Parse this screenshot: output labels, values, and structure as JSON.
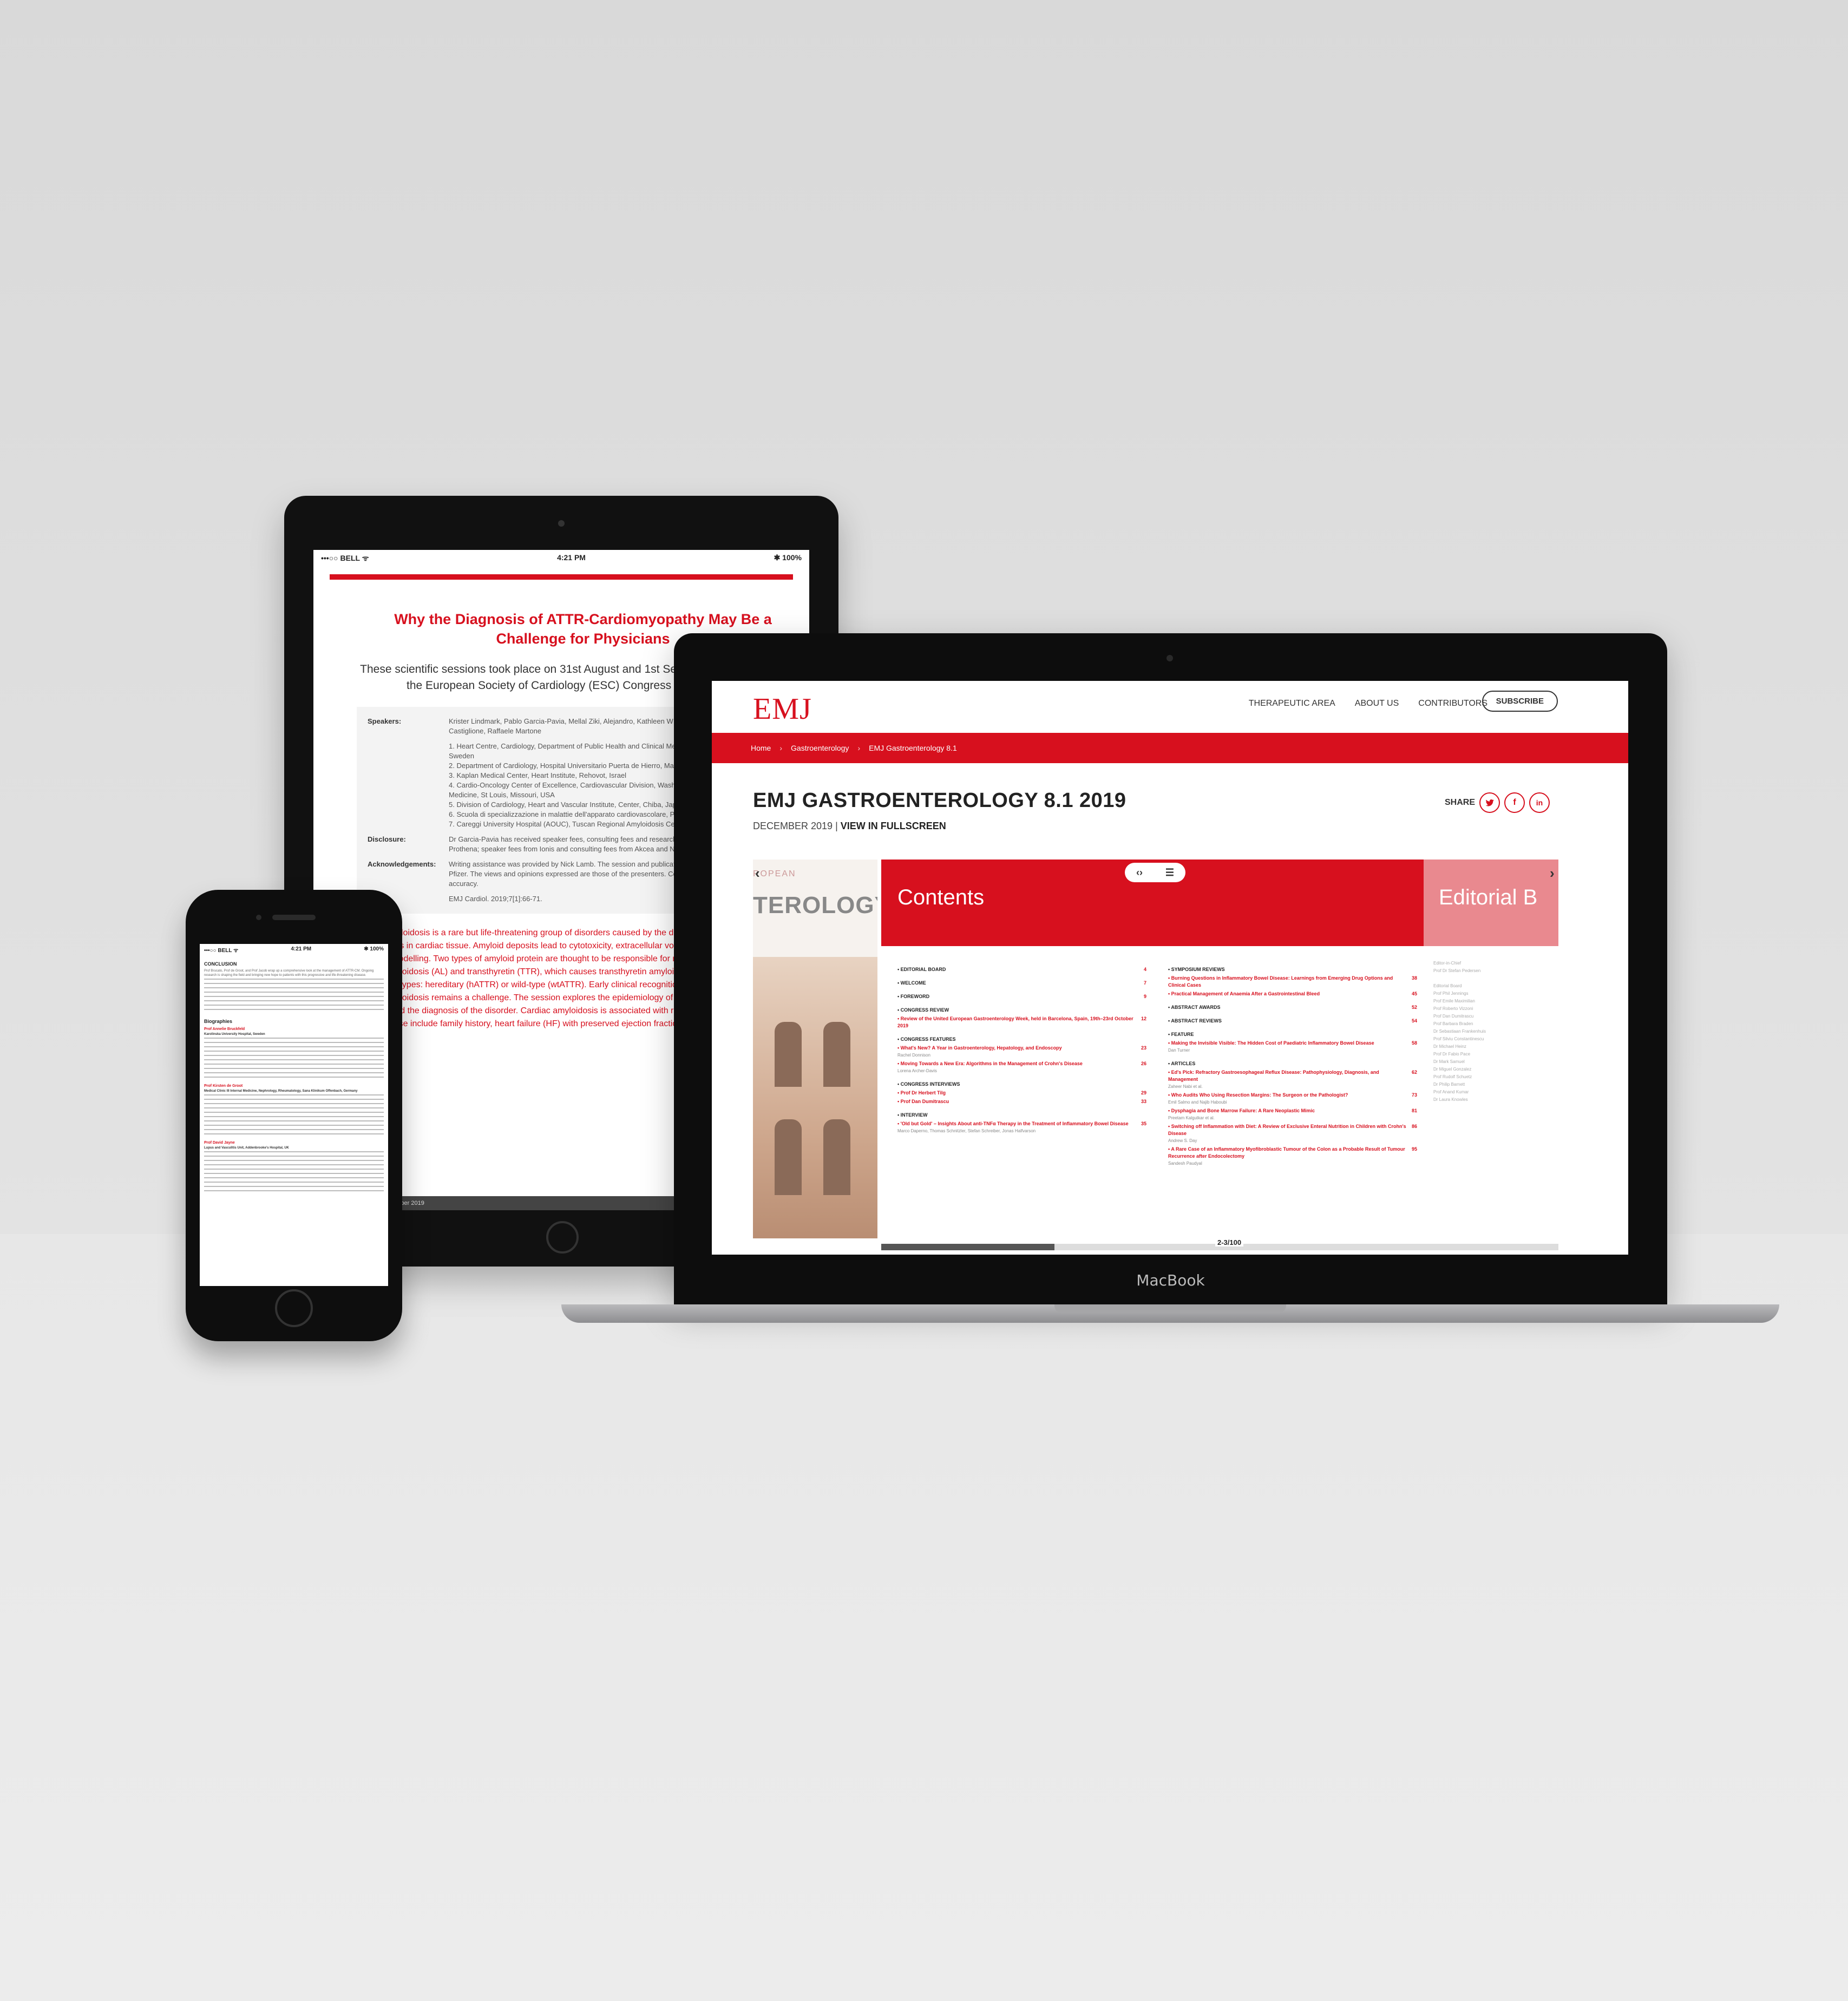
{
  "tablet": {
    "status_left": "•••○○ BELL ᯤ",
    "status_time": "4:21 PM",
    "status_right": "✱ 100%",
    "title": "Why the Diagnosis of ATTR-Cardiomyopathy May Be a Challenge for Physicians",
    "intro": "These scientific sessions took place on 31st August and 1st September 2019, as part of the European Society of Cardiology (ESC) Congress in Paris, France",
    "speakers_label": "Speakers:",
    "speakers": "Krister Lindmark, Pablo Garcia-Pavia, Mellal Ziki, Alejandro, Kathleen W Zhang, Shigeru Fukushima, Castiglione, Raffaele Martone",
    "affiliations": "1. Heart Centre, Cardiology, Department of Public Health and Clinical Medicine, Umeå University, Umeå, Sweden\n2. Department of Cardiology, Hospital Universitario Puerta de Hierro, Madrid, Spain\n3. Kaplan Medical Center, Heart Institute, Rehovot, Israel\n4. Cardio-Oncology Center of Excellence, Cardiovascular Division, Washington University School of Medicine, St Louis, Missouri, USA\n5. Division of Cardiology, Heart and Vascular Institute, Center, Chiba, Japan\n6. Scuola di specializzazione in malattie dell'apparato cardiovascolare, Pisa, Pisa, Italy\n7. Careggi University Hospital (AOUC), Tuscan Regional Amyloidosis Centre, Florence, Italy",
    "disclosure_label": "Disclosure:",
    "disclosure": "Dr Garcia-Pavia has received speaker fees, consulting fees and research support from Alnylam, Pfizer and Prothena; speaker fees from Ionis and consulting fees from Akcea and Neurimmune.",
    "ack_label": "Acknowledgements:",
    "ack": "Writing assistance was provided by Nick Lamb. The session and publication of this article were funded by Pfizer. The views and opinions expressed are those of the presenters. Content was reviewed for medical accuracy.",
    "citation": "EMJ Cardiol. 2019;7[1]:66-71.",
    "body": "Amyloidosis is a rare but life-threatening group of disorders caused by the deposition of misfolded amyloid fibrils in cardiac tissue. Amyloid deposits lead to cytotoxicity, extracellular volume expansion, and ventricular remodelling. Two types of amyloid protein are thought to be responsible for most disorders: light chain amyloidosis (AL) and transthyretin (TTR), which causes transthyretin amyloidosis (ATTR), of which there are two types: hereditary (hATTR) or wild-type (wtATTR). Early clinical recognition of the disease, cardiac amyloidosis remains a challenge. The session explores the epidemiology of AL and ATTR and the biomarkers to aid the diagnosis of the disorder. Cardiac amyloidosis is associated with rising red flag symptom clusters. These include family history, heart failure (HF) with preserved ejection fraction (HFpEF) without...",
    "footer": "EMJ CARDIOLOGY • October 2019"
  },
  "phone": {
    "status_left": "•••○○ BELL ᯤ",
    "status_time": "4:21 PM",
    "status_right": "✱ 100%",
    "heading": "CONCLUSION",
    "conclusion": "Prof Brucato, Prof de Groot, and Prof Jacob wrap up a comprehensive look at the management of ATTR-CM. Ongoing research is shaping the field and bringing new hope to patients with this progressive and life-threatening disease.",
    "bios_heading": "Biographies",
    "bio1_name": "Prof Annelie Bruckfeld",
    "bio1_aff": "Karolinska University Hospital, Sweden",
    "bio2_name": "Prof Kirsten de Groot",
    "bio2_aff": "Medical Clinic III Internal Medicine, Nephrology, Rheumatology, Sana Klinikum Offenbach, Germany",
    "bio3_name": "Prof David Jayne",
    "bio3_aff": "Lupus and Vasculitis Unit, Addenbrooke's Hospital, UK"
  },
  "laptop": {
    "brand": "MacBook",
    "logo": "EMJ",
    "nav": {
      "therapeutic_area": "THERAPEUTIC AREA",
      "about": "ABOUT US",
      "contributors": "CONTRIBUTORS",
      "subscribe": "SUBSCRIBE"
    },
    "breadcrumbs": {
      "home": "Home",
      "sep": "›",
      "section": "Gastroenterology",
      "current": "EMJ Gastroenterology 8.1"
    },
    "title": "EMJ GASTROENTEROLOGY 8.1 2019",
    "date": "DECEMBER 2019",
    "divider": "|",
    "fullscreen": "VIEW IN FULLSCREEN",
    "share_label": "SHARE",
    "share_icons": [
      "twitter-icon",
      "facebook-icon",
      "linkedin-icon"
    ],
    "viewer": {
      "cover_top": "ROPEAN",
      "cover_big": "TEROLOGY",
      "contents_title": "Contents",
      "next_title": "Editorial B",
      "page_counter": "2-3/100",
      "left_col": [
        {
          "type": "sec",
          "label": "EDITORIAL BOARD",
          "page": "4"
        },
        {
          "type": "sec",
          "label": "WELCOME",
          "page": "7"
        },
        {
          "type": "sec",
          "label": "FOREWORD",
          "page": "9"
        },
        {
          "type": "sec",
          "label": "CONGRESS REVIEW",
          "page": ""
        },
        {
          "type": "item",
          "label": "Review of the United European Gastroenterology Week, held in Barcelona, Spain, 19th–23rd October 2019",
          "page": "12"
        },
        {
          "type": "sec",
          "label": "CONGRESS FEATURES",
          "page": ""
        },
        {
          "type": "item",
          "label": "What's New? A Year in Gastroenterology, Hepatology, and Endoscopy",
          "page": "23"
        },
        {
          "type": "auth",
          "label": "Rachel Donnison"
        },
        {
          "type": "item",
          "label": "Moving Towards a New Era: Algorithms in the Management of Crohn's Disease",
          "page": "26"
        },
        {
          "type": "auth",
          "label": "Lorena Archer-Davis"
        },
        {
          "type": "sec",
          "label": "CONGRESS INTERVIEWS",
          "page": ""
        },
        {
          "type": "item",
          "label": "Prof Dr Herbert Tilg",
          "page": "29"
        },
        {
          "type": "item",
          "label": "Prof Dan Dumitrascu",
          "page": "33"
        },
        {
          "type": "sec",
          "label": "INTERVIEW",
          "page": ""
        },
        {
          "type": "item",
          "label": "'Old but Gold' – Insights About anti-TNFα Therapy in the Treatment of Inflammatory Bowel Disease",
          "page": "35"
        },
        {
          "type": "auth",
          "label": "Marco Daperno, Thomas Schnitzler, Stefan Schreiber, Jonas Halfvarson"
        }
      ],
      "right_col": [
        {
          "type": "sec",
          "label": "SYMPOSIUM REVIEWS",
          "page": ""
        },
        {
          "type": "item",
          "label": "Burning Questions in Inflammatory Bowel Disease: Learnings from Emerging Drug Options and Clinical Cases",
          "page": "38"
        },
        {
          "type": "item",
          "label": "Practical Management of Anaemia After a Gastrointestinal Bleed",
          "page": "45"
        },
        {
          "type": "sec",
          "label": "ABSTRACT AWARDS",
          "page": "52"
        },
        {
          "type": "sec",
          "label": "ABSTRACT REVIEWS",
          "page": "54"
        },
        {
          "type": "sec",
          "label": "FEATURE",
          "page": ""
        },
        {
          "type": "item",
          "label": "Making the Invisible Visible: The Hidden Cost of Paediatric Inflammatory Bowel Disease",
          "page": "58"
        },
        {
          "type": "auth",
          "label": "Dan Turner"
        },
        {
          "type": "sec",
          "label": "ARTICLES",
          "page": ""
        },
        {
          "type": "item",
          "label": "Ed's Pick: Refractory Gastroesophageal Reflux Disease: Pathophysiology, Diagnosis, and Management",
          "page": "62"
        },
        {
          "type": "auth",
          "label": "Zaheer Nabi et al."
        },
        {
          "type": "item",
          "label": "Who Audits Who Using Resection Margins: The Surgeon or the Pathologist?",
          "page": "73"
        },
        {
          "type": "auth",
          "label": "Emil Salmo and Najib Haboubi"
        },
        {
          "type": "item",
          "label": "Dysphagia and Bone Marrow Failure: A Rare Neoplastic Mimic",
          "page": "81"
        },
        {
          "type": "auth",
          "label": "Preetam Kalgutkar et al."
        },
        {
          "type": "item",
          "label": "Switching off Inflammation with Diet: A Review of Exclusive Enteral Nutrition in Children with Crohn's Disease",
          "page": "86"
        },
        {
          "type": "auth",
          "label": "Andrew S. Day"
        },
        {
          "type": "item",
          "label": "A Rare Case of an Inflammatory Myofibroblastic Tumour of the Colon as a Probable Result of Tumour Recurrence after Endocolectomy",
          "page": "95"
        },
        {
          "type": "auth",
          "label": "Sandesh Paudyal"
        }
      ],
      "editorial_list": "Editor-in-Chief\nProf Dr Stefan Pedersen\n\nEditorial Board\nProf Phil Jennings\nProf Emile Maximilian\nProf Roberto Vizzoni\nProf Dan Dumitrascu\nProf Barbara Braden\nDr Sebastiaan Frankenhuis\nProf Silviu Constantinescu\nDr Michael Heinz\nProf Dr Fabio Pace\nDr Mark Samuel\nDr Miguel Gonzalez\nProf Rudolf Schuetz\nDr Philip Barnett\nProf Anand Kumar\nDr Laura Knowles"
    }
  }
}
